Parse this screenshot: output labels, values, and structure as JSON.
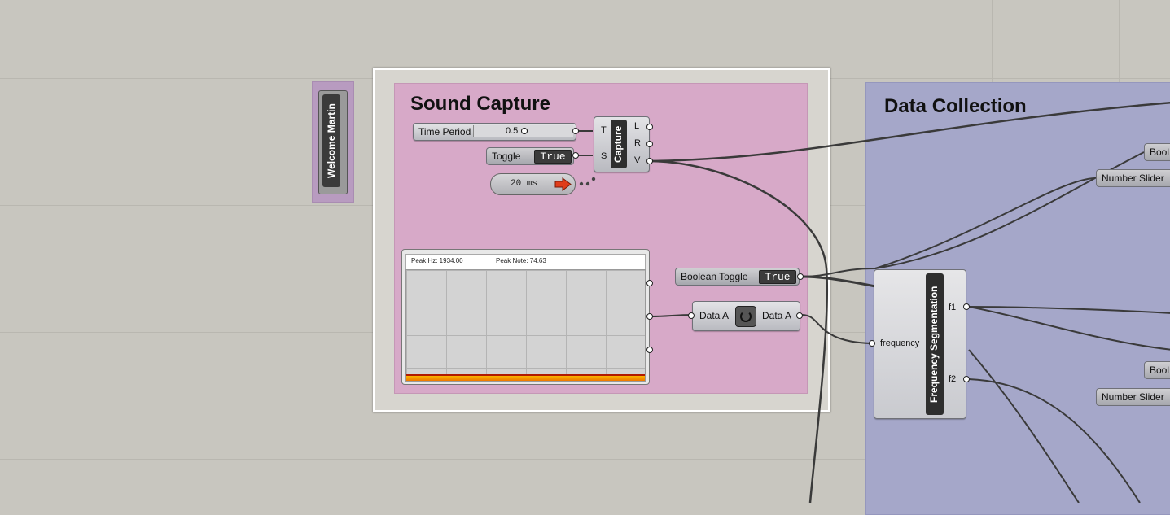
{
  "groups": {
    "sound_capture": {
      "title": "Sound Capture"
    },
    "data_collection": {
      "title": "Data Collection"
    },
    "welcome": {
      "label": "Welcome Martin"
    }
  },
  "components": {
    "time_period": {
      "label": "Time Period",
      "value": "0.5"
    },
    "toggle": {
      "label": "Toggle",
      "value": "True"
    },
    "timer": {
      "label": "20 ms"
    },
    "capture": {
      "label": "Capture",
      "in_ports": [
        "T",
        "S"
      ],
      "out_ports": [
        "L",
        "R",
        "V"
      ]
    },
    "chart": {
      "peak_hz": "Peak Hz: 1934.00",
      "peak_note": "Peak Note: 74.63"
    },
    "boolean_toggle": {
      "label": "Boolean Toggle",
      "value": "True"
    },
    "data_a": {
      "left": "Data A",
      "right": "Data A"
    },
    "freq_seg": {
      "label": "Frequency Segmentation",
      "input": "frequency",
      "outputs": [
        "f1",
        "f2"
      ]
    },
    "right_side": {
      "bool1": "Bool",
      "slider1": "Number Slider",
      "bool2": "Bool",
      "slider2": "Number Slider"
    }
  }
}
